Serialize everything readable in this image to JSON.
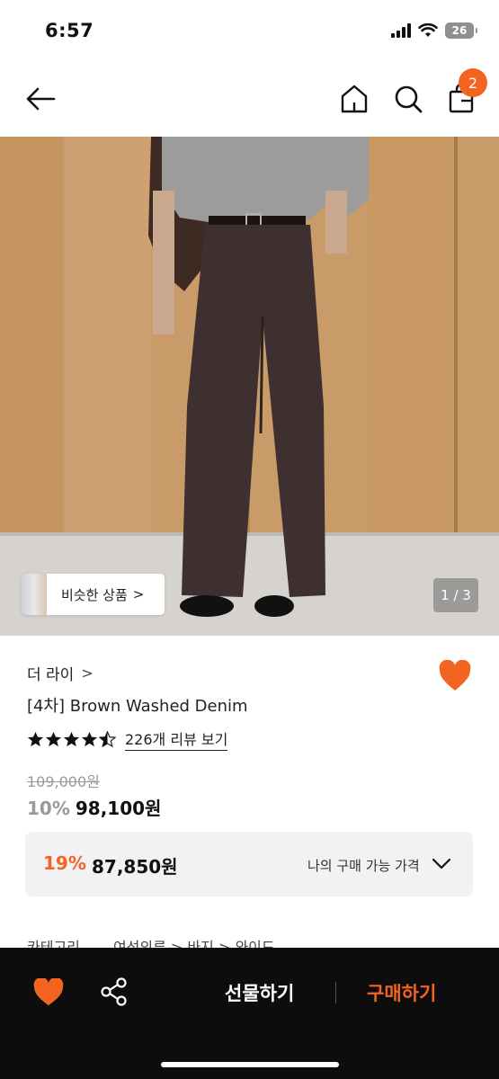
{
  "status": {
    "time": "6:57",
    "battery": "26"
  },
  "nav": {
    "cart_count": "2"
  },
  "gallery": {
    "similar_label": "비슷한 상품",
    "similar_chevron": ">",
    "page_indicator": "1 / 3"
  },
  "product": {
    "brand": "더 라이",
    "brand_chevron": ">",
    "name": "[4차] Brown Washed Denim",
    "rating": 4.5,
    "review_link": "226개 리뷰 보기",
    "original_price": "109,000원",
    "discount_rate": "10%",
    "sale_price": "98,100원"
  },
  "member_price": {
    "rate": "19%",
    "price": "87,850원",
    "label": "나의 구매 가능 가격"
  },
  "category": {
    "text": "카테고리 　　여성의류 > 바지 > 와이드"
  },
  "bottom_bar": {
    "gift_label": "선물하기",
    "buy_label": "구매하기"
  },
  "colors": {
    "accent": "#f2641f",
    "bottom_bar": "#0d0d0d",
    "member_box": "#f2f2f4"
  },
  "icons": [
    "back-arrow-icon",
    "home-icon",
    "search-icon",
    "shopping-bag-icon",
    "heart-icon",
    "share-icon",
    "chevron-down-icon",
    "star-icon"
  ]
}
